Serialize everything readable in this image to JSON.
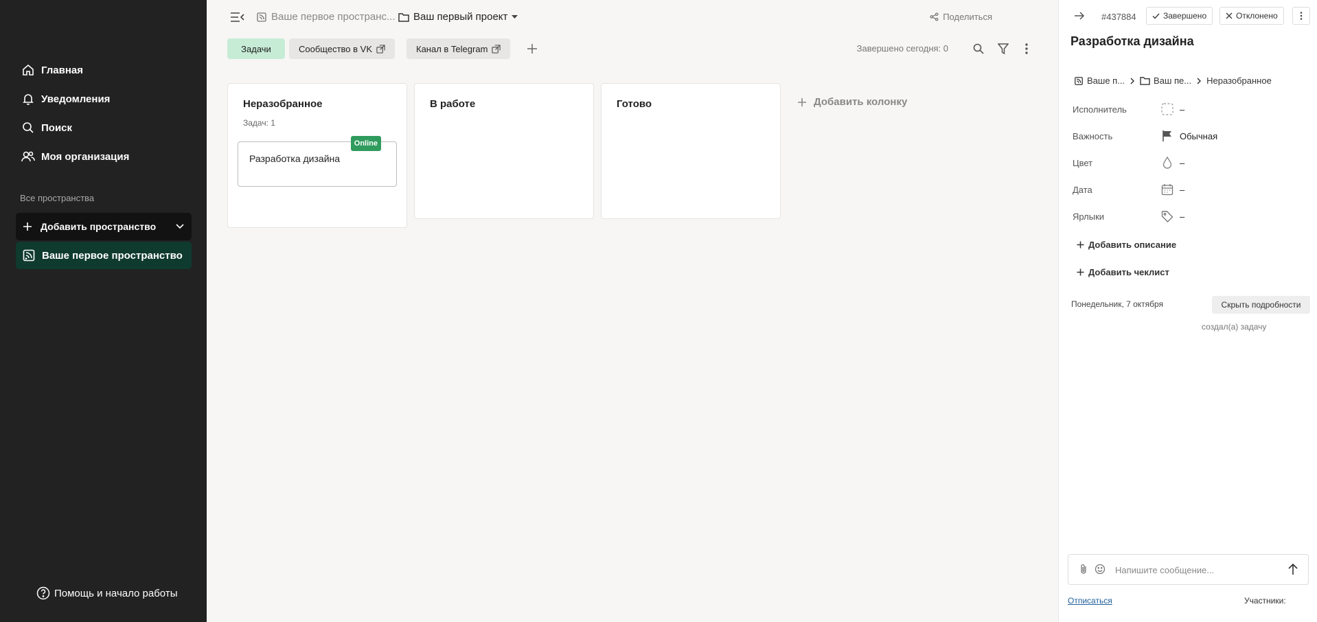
{
  "sidebar": {
    "nav": [
      {
        "label": "Главная",
        "icon": "home-icon"
      },
      {
        "label": "Уведомления",
        "icon": "bell-icon"
      },
      {
        "label": "Поиск",
        "icon": "search-icon"
      },
      {
        "label": "Моя организация",
        "icon": "users-icon"
      }
    ],
    "section_label": "Все пространства",
    "add_space": "Добавить пространство",
    "space": "Ваше первое пространство",
    "help": "Помощь и начало работы"
  },
  "topbar": {
    "space_crumb": "Ваше первое пространс...",
    "project_crumb": "Ваш первый проект",
    "share": "Поделиться"
  },
  "tabs": [
    {
      "label": "Задачи"
    },
    {
      "label": "Сообщество в VK"
    },
    {
      "label": "Канал в Telegram"
    }
  ],
  "done_today": "Завершено сегодня: 0",
  "columns": [
    {
      "title": "Неразобранное",
      "count": "Задач: 1"
    },
    {
      "title": "В работе"
    },
    {
      "title": "Готово"
    }
  ],
  "card": {
    "title": "Разработка дизайна",
    "badge": "Online"
  },
  "add_column": "Добавить колонку",
  "panel": {
    "task_id": "#437884",
    "done_button": "Завершено",
    "reject_button": "Отклонено",
    "title": "Разработка дизайна",
    "path": [
      "Ваше п...",
      "Ваш пе...",
      "Неразобранное"
    ],
    "props": [
      {
        "label": "Исполнитель",
        "value": "–"
      },
      {
        "label": "Важность",
        "value": "Обычная"
      },
      {
        "label": "Цвет",
        "value": "–"
      },
      {
        "label": "Дата",
        "value": "–"
      },
      {
        "label": "Ярлыки",
        "value": "–"
      }
    ],
    "add_description": "Добавить описание",
    "add_checklist": "Добавить чеклист",
    "date_line": "Понедельник, 7 октября",
    "hide_details": "Скрыть подробности",
    "created": "создал(а) задачу",
    "message_placeholder": "Напишите сообщение...",
    "unsubscribe": "Отписаться",
    "members": "Участники:"
  }
}
